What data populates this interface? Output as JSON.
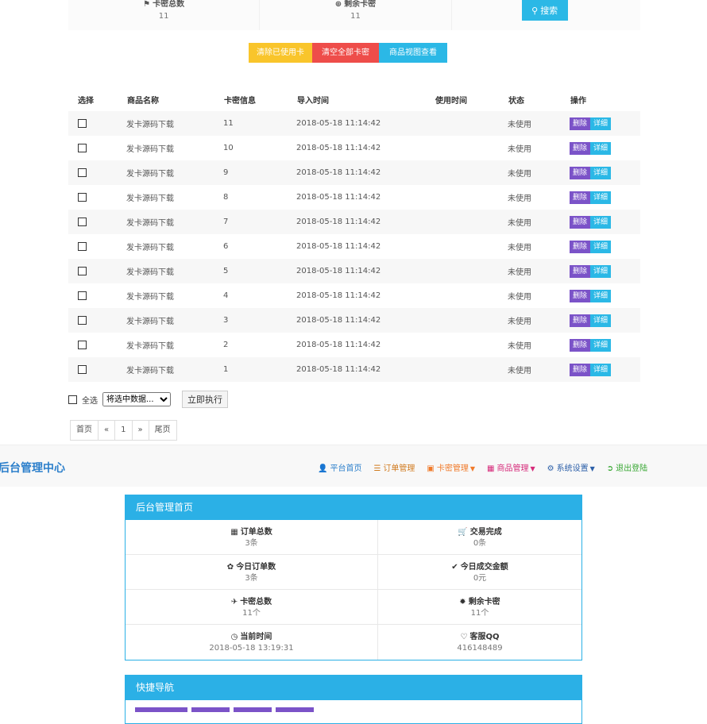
{
  "top_stats": {
    "card_total_label": "卡密总数",
    "card_total_value": "11",
    "card_remaining_label": "剩余卡密",
    "card_remaining_value": "11",
    "search_label": "搜索"
  },
  "actions": {
    "clear_used": "清除已使用卡密",
    "clear_all": "清空全部卡密",
    "product_view": "商品视图查看"
  },
  "table": {
    "headers": [
      "选择",
      "商品名称",
      "卡密信息",
      "导入时间",
      "使用时间",
      "状态",
      "操作"
    ],
    "rows": [
      {
        "name": "发卡源码下载",
        "card": "11",
        "import_time": "2018-05-18 11:14:42",
        "use_time": "",
        "status": "未使用"
      },
      {
        "name": "发卡源码下载",
        "card": "10",
        "import_time": "2018-05-18 11:14:42",
        "use_time": "",
        "status": "未使用"
      },
      {
        "name": "发卡源码下载",
        "card": "9",
        "import_time": "2018-05-18 11:14:42",
        "use_time": "",
        "status": "未使用"
      },
      {
        "name": "发卡源码下载",
        "card": "8",
        "import_time": "2018-05-18 11:14:42",
        "use_time": "",
        "status": "未使用"
      },
      {
        "name": "发卡源码下载",
        "card": "7",
        "import_time": "2018-05-18 11:14:42",
        "use_time": "",
        "status": "未使用"
      },
      {
        "name": "发卡源码下载",
        "card": "6",
        "import_time": "2018-05-18 11:14:42",
        "use_time": "",
        "status": "未使用"
      },
      {
        "name": "发卡源码下载",
        "card": "5",
        "import_time": "2018-05-18 11:14:42",
        "use_time": "",
        "status": "未使用"
      },
      {
        "name": "发卡源码下载",
        "card": "4",
        "import_time": "2018-05-18 11:14:42",
        "use_time": "",
        "status": "未使用"
      },
      {
        "name": "发卡源码下载",
        "card": "3",
        "import_time": "2018-05-18 11:14:42",
        "use_time": "",
        "status": "未使用"
      },
      {
        "name": "发卡源码下载",
        "card": "2",
        "import_time": "2018-05-18 11:14:42",
        "use_time": "",
        "status": "未使用"
      },
      {
        "name": "发卡源码下载",
        "card": "1",
        "import_time": "2018-05-18 11:14:42",
        "use_time": "",
        "status": "未使用"
      }
    ],
    "delete_label": "删除",
    "detail_label": "详细"
  },
  "bulk": {
    "select_all": "全选",
    "select_option": "将选中数据...",
    "execute": "立即执行"
  },
  "pager": {
    "first": "首页",
    "prev": "«",
    "current": "1",
    "next": "»",
    "last": "尾页"
  },
  "navbar": {
    "brand": "后台管理中心",
    "items": [
      {
        "label": "平台首页",
        "icon": "user-icon",
        "color": "#2c7fcb",
        "dropdown": false
      },
      {
        "label": "订单管理",
        "icon": "list-icon",
        "color": "#d07a1e",
        "dropdown": false
      },
      {
        "label": "卡密管理",
        "icon": "card-icon",
        "color": "#f07a2a",
        "dropdown": true
      },
      {
        "label": "商品管理",
        "icon": "product-icon",
        "color": "#d62a7a",
        "dropdown": true
      },
      {
        "label": "系统设置",
        "icon": "gear-icon",
        "color": "#2c5fa8",
        "dropdown": true
      },
      {
        "label": "退出登陆",
        "icon": "logout-icon",
        "color": "#3aa835",
        "dropdown": false
      }
    ]
  },
  "home_panel": {
    "title": "后台管理首页",
    "stats": [
      {
        "label": "订单总数",
        "value": "3条",
        "icon": "grid-icon"
      },
      {
        "label": "交易完成",
        "value": "0条",
        "icon": "cart-icon"
      },
      {
        "label": "今日订单数",
        "value": "3条",
        "icon": "leaf-icon"
      },
      {
        "label": "今日成交金额",
        "value": "0元",
        "icon": "check-icon"
      },
      {
        "label": "卡密总数",
        "value": "11个",
        "icon": "plane-icon"
      },
      {
        "label": "剩余卡密",
        "value": "11个",
        "icon": "star-icon"
      },
      {
        "label": "当前时间",
        "value": "2018-05-18 13:19:31",
        "icon": "clock-icon"
      },
      {
        "label": "客服QQ",
        "value": "416148489",
        "icon": "heart-icon"
      }
    ]
  },
  "quick_panel": {
    "title": "快捷导航"
  }
}
